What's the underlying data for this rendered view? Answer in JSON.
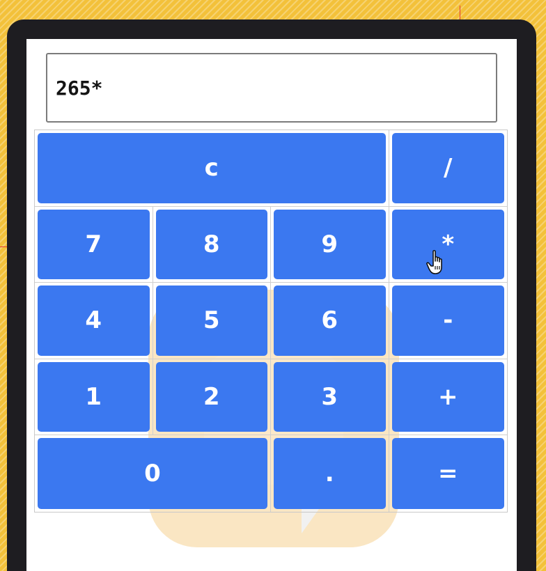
{
  "display": {
    "value": "265*"
  },
  "keys": {
    "clear": "c",
    "divide": "/",
    "seven": "7",
    "eight": "8",
    "nine": "9",
    "multiply": "*",
    "four": "4",
    "five": "5",
    "six": "6",
    "subtract": "-",
    "one": "1",
    "two": "2",
    "three": "3",
    "add": "+",
    "zero": "0",
    "decimal": ".",
    "equals": "="
  },
  "colors": {
    "key_background": "#3b78f0",
    "key_text": "#ffffff",
    "device_frame": "#1e1d21",
    "page_background": "#f3c13a"
  },
  "icons": {
    "pointer": "hand-pointer-icon"
  }
}
